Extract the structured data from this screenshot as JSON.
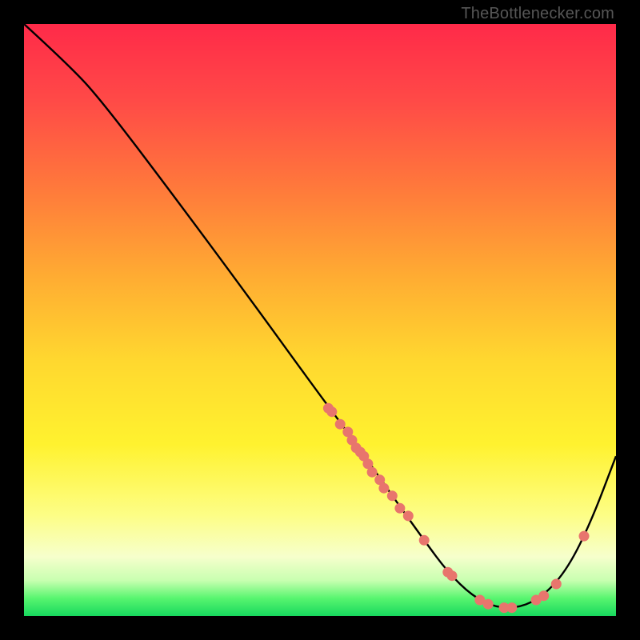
{
  "watermark": "TheBottlenecker.com",
  "chart_data": {
    "type": "line",
    "title": "",
    "xlabel": "",
    "ylabel": "",
    "xlim": [
      0,
      100
    ],
    "ylim": [
      0,
      100
    ],
    "curve": [
      {
        "x": 0,
        "y": 100
      },
      {
        "x": 8.1,
        "y": 92.6
      },
      {
        "x": 13.5,
        "y": 86.5
      },
      {
        "x": 24.3,
        "y": 72.3
      },
      {
        "x": 37.8,
        "y": 54.1
      },
      {
        "x": 48.6,
        "y": 39.2
      },
      {
        "x": 56.1,
        "y": 29.1
      },
      {
        "x": 62.2,
        "y": 20.3
      },
      {
        "x": 67.6,
        "y": 12.8
      },
      {
        "x": 71.6,
        "y": 7.4
      },
      {
        "x": 75.7,
        "y": 3.4
      },
      {
        "x": 79.7,
        "y": 1.4
      },
      {
        "x": 83.8,
        "y": 1.4
      },
      {
        "x": 87.8,
        "y": 3.4
      },
      {
        "x": 91.9,
        "y": 8.1
      },
      {
        "x": 95.9,
        "y": 16.2
      },
      {
        "x": 100,
        "y": 27.0
      }
    ],
    "dots": [
      {
        "x": 51.4,
        "y": 35.1
      },
      {
        "x": 52.0,
        "y": 34.5
      },
      {
        "x": 53.4,
        "y": 32.4
      },
      {
        "x": 54.7,
        "y": 31.1
      },
      {
        "x": 55.4,
        "y": 29.7
      },
      {
        "x": 56.1,
        "y": 28.4
      },
      {
        "x": 56.8,
        "y": 27.7
      },
      {
        "x": 57.4,
        "y": 27.0
      },
      {
        "x": 58.1,
        "y": 25.7
      },
      {
        "x": 58.8,
        "y": 24.3
      },
      {
        "x": 60.1,
        "y": 23.0
      },
      {
        "x": 60.8,
        "y": 21.6
      },
      {
        "x": 62.2,
        "y": 20.3
      },
      {
        "x": 63.5,
        "y": 18.2
      },
      {
        "x": 64.9,
        "y": 16.9
      },
      {
        "x": 67.6,
        "y": 12.8
      },
      {
        "x": 71.6,
        "y": 7.4
      },
      {
        "x": 72.3,
        "y": 6.8
      },
      {
        "x": 77.0,
        "y": 2.7
      },
      {
        "x": 78.4,
        "y": 2.0
      },
      {
        "x": 81.1,
        "y": 1.4
      },
      {
        "x": 82.4,
        "y": 1.4
      },
      {
        "x": 86.5,
        "y": 2.7
      },
      {
        "x": 87.8,
        "y": 3.4
      },
      {
        "x": 89.9,
        "y": 5.4
      },
      {
        "x": 94.6,
        "y": 13.5
      }
    ],
    "colors": {
      "line": "#000000",
      "dot": "#e8756d"
    }
  }
}
